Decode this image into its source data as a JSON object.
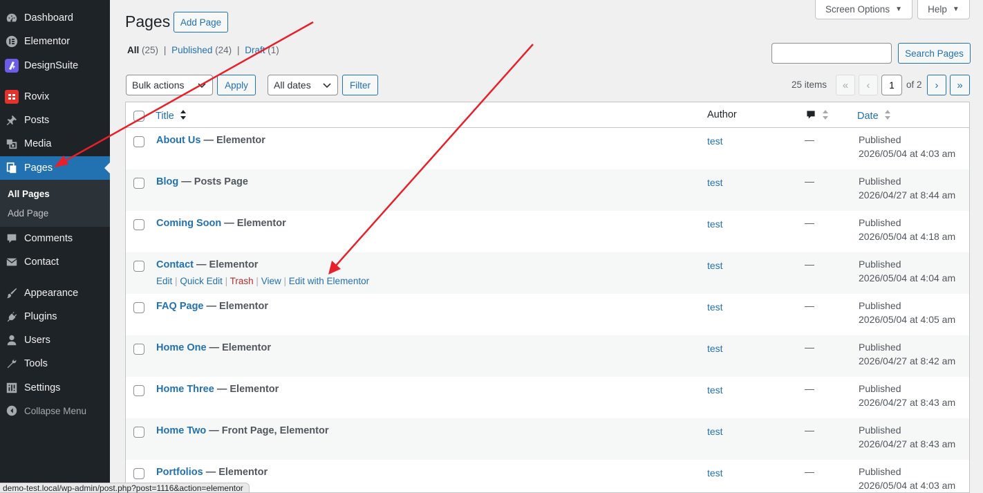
{
  "sidebar": {
    "items": [
      {
        "label": "Dashboard",
        "icon": "dashboard-icon"
      },
      {
        "label": "Elementor",
        "icon": "elementor-icon"
      },
      {
        "label": "DesignSuite",
        "icon": "designsuite-icon"
      },
      {
        "label": "Rovix",
        "icon": "rovix-icon"
      },
      {
        "label": "Posts",
        "icon": "pushpin-icon"
      },
      {
        "label": "Media",
        "icon": "media-icon"
      },
      {
        "label": "Pages",
        "icon": "pages-icon"
      },
      {
        "label": "Comments",
        "icon": "comment-icon"
      },
      {
        "label": "Contact",
        "icon": "mail-icon"
      },
      {
        "label": "Appearance",
        "icon": "brush-icon"
      },
      {
        "label": "Plugins",
        "icon": "plug-icon"
      },
      {
        "label": "Users",
        "icon": "user-icon"
      },
      {
        "label": "Tools",
        "icon": "wrench-icon"
      },
      {
        "label": "Settings",
        "icon": "settings-icon"
      }
    ],
    "submenu": [
      "All Pages",
      "Add Page"
    ],
    "collapse": "Collapse Menu"
  },
  "header": {
    "title": "Pages",
    "add_button": "Add Page",
    "screen_options": "Screen Options",
    "help": "Help"
  },
  "filters": {
    "all_label": "All",
    "all_count": "(25)",
    "published_label": "Published",
    "published_count": "(24)",
    "draft_label": "Draft",
    "draft_count": "(1)",
    "separator": "|"
  },
  "search": {
    "value": "",
    "button": "Search Pages"
  },
  "toolbar": {
    "bulk_actions": "Bulk actions",
    "apply": "Apply",
    "all_dates": "All dates",
    "filter": "Filter"
  },
  "pagination": {
    "items": "25 items",
    "first": "«",
    "prev": "‹",
    "current": "1",
    "of": "of 2",
    "next": "›",
    "last": "»"
  },
  "table": {
    "headers": {
      "title": "Title",
      "author": "Author",
      "date": "Date"
    },
    "rows": [
      {
        "title": "About Us",
        "state": " — Elementor",
        "author": "test",
        "comments": "—",
        "status": "Published",
        "date": "2026/05/04 at 4:03 am"
      },
      {
        "title": "Blog",
        "state": " — Posts Page",
        "author": "test",
        "comments": "—",
        "status": "Published",
        "date": "2026/04/27 at 8:44 am"
      },
      {
        "title": "Coming Soon",
        "state": " — Elementor",
        "author": "test",
        "comments": "—",
        "status": "Published",
        "date": "2026/05/04 at 4:18 am"
      },
      {
        "title": "Contact",
        "state": " — Elementor",
        "author": "test",
        "comments": "—",
        "status": "Published",
        "date": "2026/05/04 at 4:04 am"
      },
      {
        "title": "FAQ Page",
        "state": " — Elementor",
        "author": "test",
        "comments": "—",
        "status": "Published",
        "date": "2026/05/04 at 4:05 am"
      },
      {
        "title": "Home One",
        "state": " — Elementor",
        "author": "test",
        "comments": "—",
        "status": "Published",
        "date": "2026/04/27 at 8:42 am"
      },
      {
        "title": "Home Three",
        "state": " — Elementor",
        "author": "test",
        "comments": "—",
        "status": "Published",
        "date": "2026/04/27 at 8:43 am"
      },
      {
        "title": "Home Two",
        "state": " — Front Page, Elementor",
        "author": "test",
        "comments": "—",
        "status": "Published",
        "date": "2026/04/27 at 8:43 am"
      },
      {
        "title": "Portfolios",
        "state": " — Elementor",
        "author": "test",
        "comments": "—",
        "status": "Published",
        "date": "2026/05/04 at 4:03 am"
      }
    ],
    "row_actions": {
      "edit": "Edit",
      "quick_edit": "Quick Edit",
      "trash": "Trash",
      "view": "View",
      "edit_elementor": "Edit with Elementor",
      "sep": "|"
    }
  },
  "status_bar_url": "demo-test.local/wp-admin/post.php?post=1116&action=elementor",
  "colors": {
    "sidebar_bg": "#1d2327",
    "accent": "#2271b1",
    "trash": "#b32d2e",
    "annotation_arrow": "#e8202a"
  }
}
